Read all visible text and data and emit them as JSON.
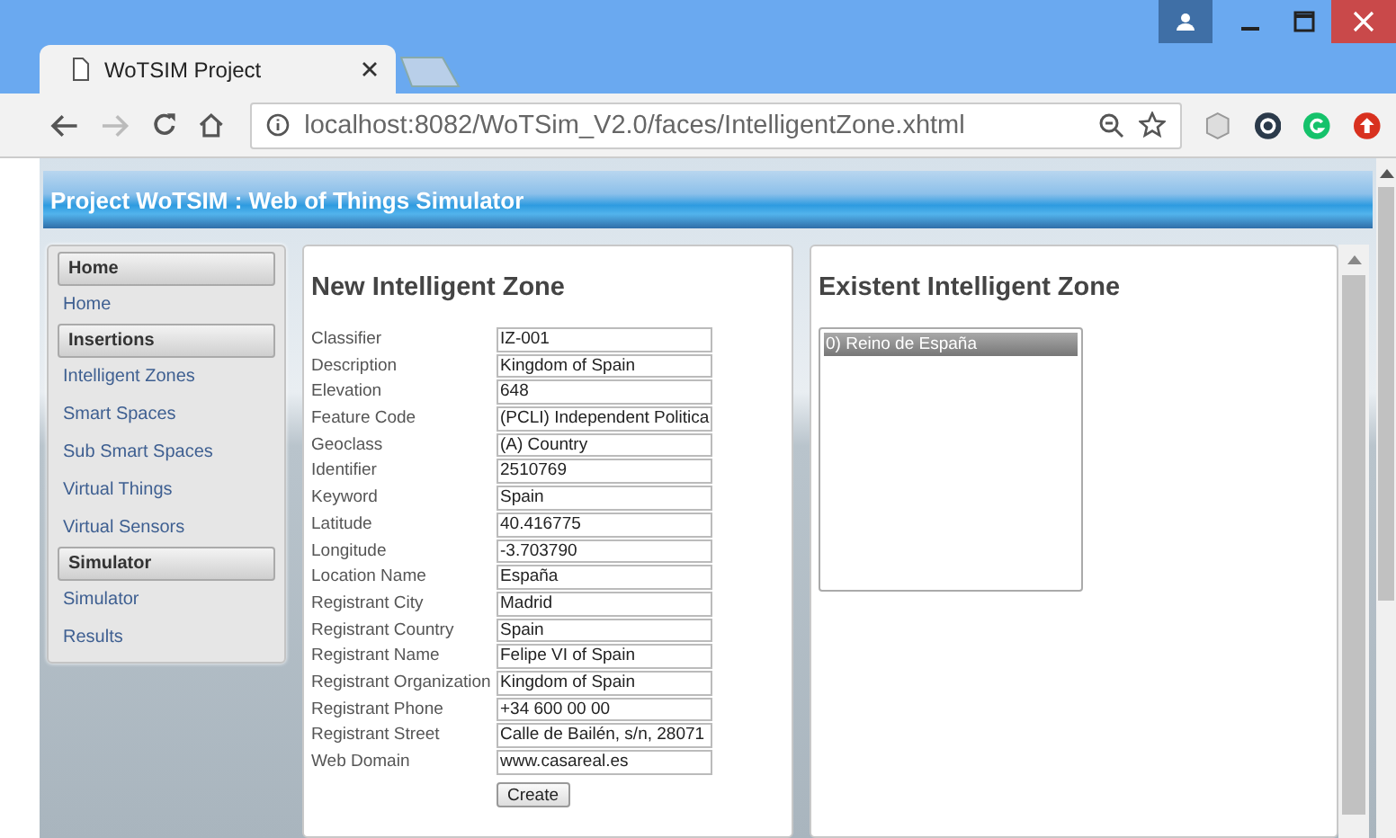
{
  "browser": {
    "tab_title": "WoTSIM Project",
    "url": "localhost:8082/WoTSim_V2.0/faces/IntelligentZone.xhtml"
  },
  "header": {
    "title": "Project WoTSIM : Web of Things Simulator"
  },
  "sidebar": {
    "sections": [
      {
        "heading": "Home",
        "items": [
          {
            "label": "Home"
          }
        ]
      },
      {
        "heading": "Insertions",
        "items": [
          {
            "label": "Intelligent Zones"
          },
          {
            "label": "Smart Spaces"
          },
          {
            "label": "Sub Smart Spaces"
          },
          {
            "label": "Virtual Things"
          },
          {
            "label": "Virtual Sensors"
          }
        ]
      },
      {
        "heading": "Simulator",
        "items": [
          {
            "label": "Simulator"
          },
          {
            "label": "Results"
          }
        ]
      }
    ]
  },
  "form": {
    "title": "New Intelligent Zone",
    "fields": [
      {
        "label": "Classifier",
        "value": "IZ-001"
      },
      {
        "label": "Description",
        "value": "Kingdom of Spain"
      },
      {
        "label": "Elevation",
        "value": "648"
      },
      {
        "label": "Feature Code",
        "value": "(PCLI) Independent Politica"
      },
      {
        "label": "Geoclass",
        "value": "(A) Country"
      },
      {
        "label": "Identifier",
        "value": "2510769"
      },
      {
        "label": "Keyword",
        "value": "Spain"
      },
      {
        "label": "Latitude",
        "value": "40.416775"
      },
      {
        "label": "Longitude",
        "value": "-3.703790"
      },
      {
        "label": "Location Name",
        "value": "España"
      },
      {
        "label": "Registrant City",
        "value": "Madrid"
      },
      {
        "label": "Registrant Country",
        "value": "Spain"
      },
      {
        "label": "Registrant Name",
        "value": "Felipe VI of Spain"
      },
      {
        "label": "Registrant Organization",
        "value": "Kingdom of Spain"
      },
      {
        "label": "Registrant Phone",
        "value": "+34 600 00 00"
      },
      {
        "label": "Registrant Street",
        "value": "Calle de Bailén, s/n, 28071"
      },
      {
        "label": "Web Domain",
        "value": "www.casareal.es"
      }
    ],
    "button": "Create"
  },
  "existing": {
    "title": "Existent Intelligent Zone",
    "items": [
      {
        "label": "0) Reino de España",
        "selected": true
      }
    ]
  }
}
